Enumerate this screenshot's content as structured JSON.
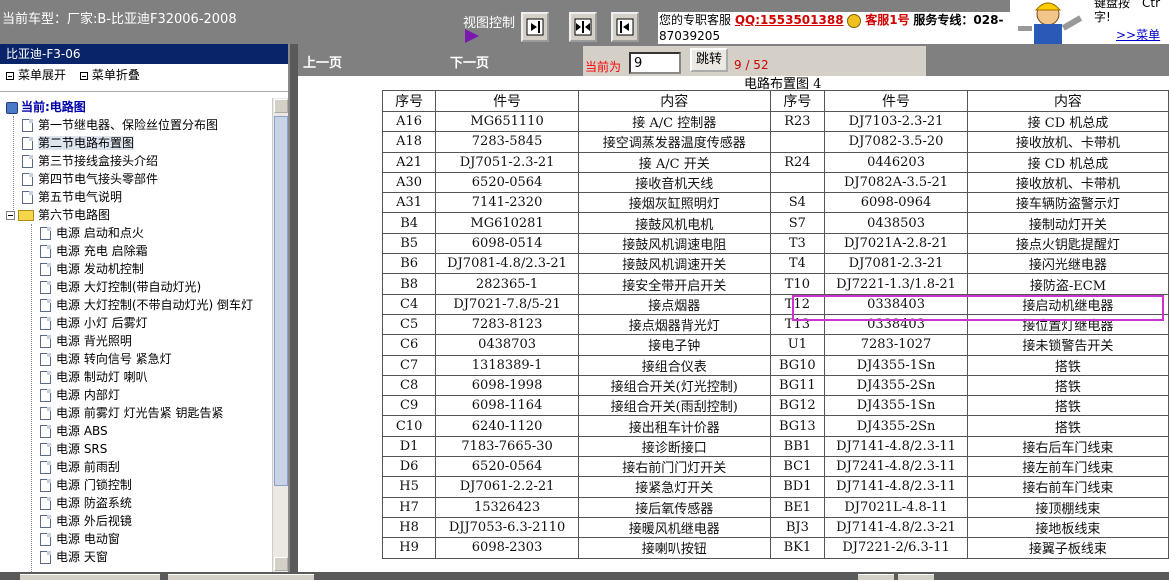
{
  "topbar": {
    "car_model": "当前车型：厂家:B-比亚迪F32006-2008",
    "view_control": "视图控制",
    "service_prefix": "您的专职客服",
    "service_qq": "QQ:1553501388",
    "service_kefu": "客服1号",
    "service_hotline": "服务专线：028-",
    "service_phone": "87039205",
    "helper_text1": "键盘按　Ctr",
    "helper_text2": "字!",
    "helper_link": ">>菜单关"
  },
  "left": {
    "title": "比亚迪-F3-06",
    "expand_all": "菜单展开",
    "collapse_all": "菜单折叠",
    "root": "当前:电路图",
    "sections": [
      "第一节继电器、保险丝位置分布图",
      "第二节电路布置图",
      "第三节接线盒接头介绍",
      "第四节电气接头零部件",
      "第五节电气说明",
      "第六节电路图"
    ],
    "circuits": [
      "电源 启动和点火",
      "电源 充电 启除霜",
      "电源 发动机控制",
      "电源 大灯控制(带自动灯光)",
      "电源 大灯控制(不带自动灯光) 倒车灯",
      "电源 小灯 后雾灯",
      "电源 背光照明",
      "电源 转向信号 紧急灯",
      "电源 制动灯 喇叭",
      "电源 内部灯",
      "电源 前雾灯 灯光告紧 钥匙告紧",
      "电源 ABS",
      "电源 SRS",
      "电源 前雨刮",
      "电源 门锁控制",
      "电源 防盗系统",
      "电源 外后视镜",
      "电源 电动窗",
      "电源 天窗"
    ]
  },
  "nav": {
    "prev": "上一页",
    "next": "下一页",
    "current_label": "当前为",
    "page_value": "9",
    "jump": "跳转",
    "page_count": "9 / 52"
  },
  "diagram_title": "电路布置图 4",
  "table": {
    "headers": [
      "序号",
      "件号",
      "内容",
      "序号",
      "件号",
      "内容"
    ],
    "rows": [
      [
        "A16",
        "MG651110",
        "接 A/C 控制器",
        "R23",
        "DJ7103-2.3-21",
        "接 CD 机总成"
      ],
      [
        "A18",
        "7283-5845",
        "接空调蒸发器温度传感器",
        "",
        "DJ7082-3.5-20",
        "接收放机、卡带机"
      ],
      [
        "A21",
        "DJ7051-2.3-21",
        "接 A/C 开关",
        "R24",
        "0446203",
        "接 CD 机总成"
      ],
      [
        "A30",
        "6520-0564",
        "接收音机天线",
        "",
        "DJ7082A-3.5-21",
        "接收放机、卡带机"
      ],
      [
        "A31",
        "7141-2320",
        "接烟灰缸照明灯",
        "S4",
        "6098-0964",
        "接车辆防盗警示灯"
      ],
      [
        "B4",
        "MG610281",
        "接鼓风机电机",
        "S7",
        "0438503",
        "接制动灯开关"
      ],
      [
        "B5",
        "6098-0514",
        "接鼓风机调速电阻",
        "T3",
        "DJ7021A-2.8-21",
        "接点火钥匙提醒灯"
      ],
      [
        "B6",
        "DJ7081-4.8/2.3-21",
        "接鼓风机调速开关",
        "T4",
        "DJ7081-2.3-21",
        "接闪光继电器"
      ],
      [
        "B8",
        "282365-1",
        "接安全带开启开关",
        "T10",
        "DJ7221-1.3/1.8-21",
        "接防盗-ECM"
      ],
      [
        "C4",
        "DJ7021-7.8/5-21",
        "接点烟器",
        "T12",
        "0338403",
        "接启动机继电器"
      ],
      [
        "C5",
        "7283-8123",
        "接点烟器背光灯",
        "T13",
        "0338403",
        "接位置灯继电器"
      ],
      [
        "C6",
        "0438703",
        "接电子钟",
        "U1",
        "7283-1027",
        "接未锁警告开关"
      ],
      [
        "C7",
        "1318389-1",
        "接组合仪表",
        "BG10",
        "DJ4355-1Sn",
        "搭铁"
      ],
      [
        "C8",
        "6098-1998",
        "接组合开关(灯光控制)",
        "BG11",
        "DJ4355-2Sn",
        "搭铁"
      ],
      [
        "C9",
        "6098-1164",
        "接组合开关(雨刮控制)",
        "BG12",
        "DJ4355-1Sn",
        "搭铁"
      ],
      [
        "C10",
        "6240-1120",
        "接出租车计价器",
        "BG13",
        "DJ4355-2Sn",
        "搭铁"
      ],
      [
        "D1",
        "7183-7665-30",
        "接诊断接口",
        "BB1",
        "DJ7141-4.8/2.3-11",
        "接右后车门线束"
      ],
      [
        "D6",
        "6520-0564",
        "接右前门门灯开关",
        "BC1",
        "DJ7241-4.8/2.3-11",
        "接左前车门线束"
      ],
      [
        "H5",
        "DJ7061-2.2-21",
        "接紧急灯开关",
        "BD1",
        "DJ7141-4.8/2.3-11",
        "接右前车门线束"
      ],
      [
        "H7",
        "15326423",
        "接后氧传感器",
        "BE1",
        "DJ7021L-4.8-11",
        "接顶棚线束"
      ],
      [
        "H8",
        "DJJ7053-6.3-2110",
        "接暖风机继电器",
        "BJ3",
        "DJ7141-4.8/2.3-21",
        "接地板线束"
      ],
      [
        "H9",
        "6098-2303",
        "接喇叭按钮",
        "BK1",
        "DJ7221-2/6.3-11",
        "接翼子板线束"
      ]
    ]
  },
  "colors": {
    "highlight": "#d030d0",
    "title_bar": "#0a246a",
    "bar_gray": "#808080"
  }
}
